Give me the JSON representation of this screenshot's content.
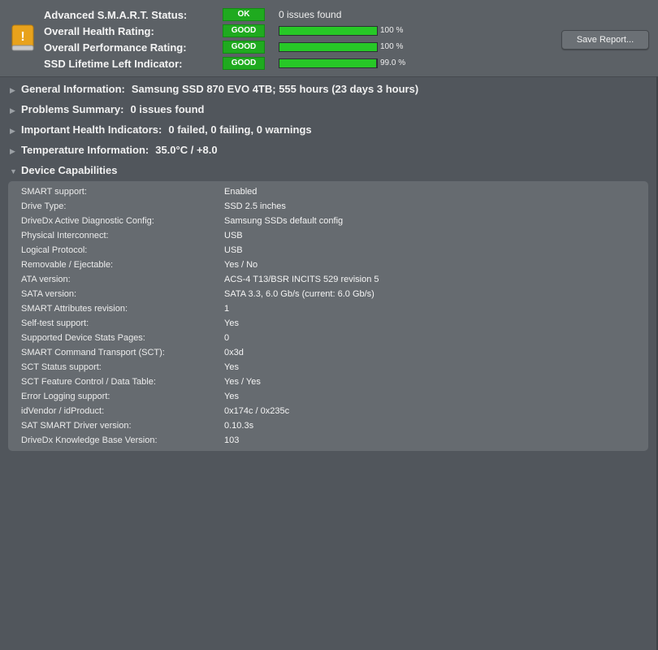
{
  "summary": {
    "rows": [
      {
        "label": "Advanced S.M.A.R.T. Status:",
        "badge": "OK",
        "detail": "0 issues found"
      },
      {
        "label": "Overall Health Rating:",
        "badge": "GOOD",
        "percent_text": "100 %",
        "level": 1.0
      },
      {
        "label": "Overall Performance Rating:",
        "badge": "GOOD",
        "percent_text": "100 %",
        "level": 1.0
      },
      {
        "label": "SSD Lifetime Left Indicator:",
        "badge": "GOOD",
        "percent_text": "99.0 %",
        "level": 0.99
      }
    ],
    "save_button": "Save Report...",
    "icon": "drive-warning-icon"
  },
  "sections": [
    {
      "title": "General Information:",
      "value": "Samsung SSD 870 EVO 4TB; 555 hours (23 days 3 hours)",
      "expanded": false
    },
    {
      "title": "Problems Summary:",
      "value": "0 issues found",
      "expanded": false
    },
    {
      "title": "Important Health Indicators:",
      "value": "0 failed, 0 failing, 0 warnings",
      "expanded": false
    },
    {
      "title": "Temperature Information:",
      "value": "35.0°C / +8.0",
      "expanded": false
    },
    {
      "title": "Device Capabilities",
      "value": "",
      "expanded": true
    }
  ],
  "capabilities": [
    {
      "label": "SMART support:",
      "value": "Enabled"
    },
    {
      "label": "Drive Type:",
      "value": "SSD 2.5 inches"
    },
    {
      "label": "DriveDx Active Diagnostic Config:",
      "value": "Samsung SSDs default config"
    },
    {
      "label": "Physical Interconnect:",
      "value": "USB"
    },
    {
      "label": "Logical Protocol:",
      "value": "USB"
    },
    {
      "label": "Removable / Ejectable:",
      "value": "Yes / No"
    },
    {
      "label": "ATA version:",
      "value": "ACS-4 T13/BSR INCITS 529 revision 5"
    },
    {
      "label": "SATA version:",
      "value": "SATA 3.3, 6.0 Gb/s (current: 6.0 Gb/s)"
    },
    {
      "label": "SMART Attributes revision:",
      "value": "1"
    },
    {
      "label": "Self-test support:",
      "value": "Yes"
    },
    {
      "label": "Supported Device Stats Pages:",
      "value": "0"
    },
    {
      "label": "SMART Command Transport (SCT):",
      "value": "0x3d"
    },
    {
      "label": "SCT Status support:",
      "value": "Yes"
    },
    {
      "label": "SCT Feature Control / Data Table:",
      "value": "Yes / Yes"
    },
    {
      "label": "Error Logging support:",
      "value": "Yes"
    },
    {
      "label": "idVendor / idProduct:",
      "value": "0x174c / 0x235c"
    },
    {
      "label": "SAT SMART Driver version:",
      "value": "0.10.3s"
    },
    {
      "label": "DriveDx Knowledge Base Version:",
      "value": "103"
    }
  ],
  "colors": {
    "good_badge": "#1faa1f",
    "bar_fill": "#27c827",
    "background": "#51565c",
    "panel": "#666b70"
  }
}
